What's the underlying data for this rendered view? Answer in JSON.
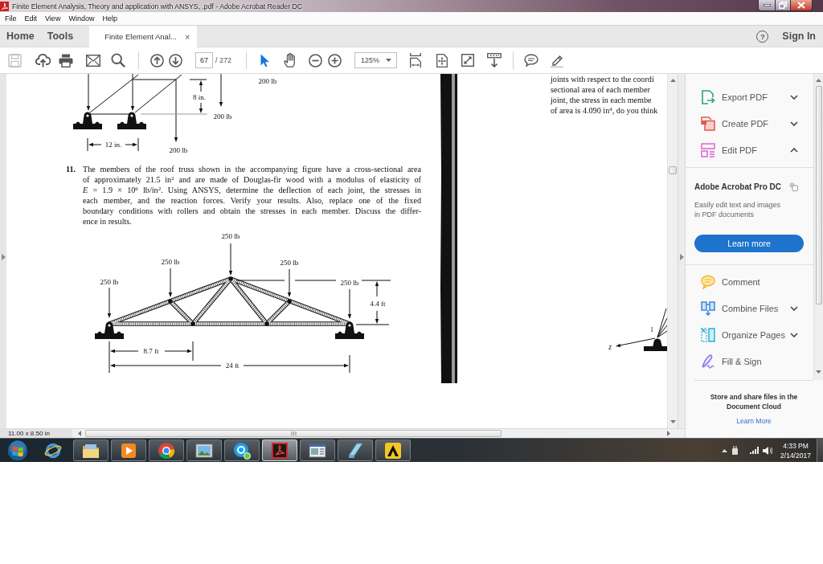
{
  "window": {
    "title": "Finite Element Analysis, Theory and application with ANSYS, .pdf - Adobe Acrobat Reader DC"
  },
  "menu_bar": [
    "File",
    "Edit",
    "View",
    "Window",
    "Help"
  ],
  "tabs": [
    {
      "kind": "nav",
      "label": "Home",
      "selected": false
    },
    {
      "kind": "nav",
      "label": "Tools",
      "selected": false
    },
    {
      "kind": "document",
      "label": "Finite Element Anal...",
      "close": "×",
      "selected": true
    }
  ],
  "account": {
    "help": "?",
    "sign_in": "Sign In"
  },
  "toolbar": {
    "save": {
      "disabled": true
    },
    "page_number": "67",
    "page_count": "/ 272",
    "pointer_tools": [
      {
        "selected": true
      },
      {
        "selected": false
      }
    ],
    "zoom": "125%"
  },
  "document": {
    "top_figure": {
      "labels": [
        "200 lb",
        "8 in.",
        "200 lb",
        "12 in.",
        "200 lb"
      ]
    },
    "problem": {
      "number": "11.",
      "lines": [
        "The members of the roof truss shown in the accompanying figure have a cross-sectional area",
        "of approximately 21.5 in$^{2}$ and are made of Douglas-fir wood with a modulus of elasticity of",
        "*E* = 1.9 × 10$^{6}$ lb/in$^{2}$. Using ANSYS, determine the deflection of each joint, the stresses in",
        "each member, and the reaction forces. Verify your results. Also, replace one of the fixed",
        "boundary conditions with rollers and obtain the stresses in each member. Discuss the differ-",
        "ence in results."
      ]
    },
    "truss_figure": {
      "labels": [
        "250 lb",
        "250 lb",
        "250 lb",
        "250 lb",
        "250 lb",
        "4.4 ft",
        "8.7 ft",
        "24 ft"
      ]
    },
    "right_column": {
      "lines": [
        "joints with respect to the coordi",
        "sectional area of each member",
        "joint, the stress in each membe",
        "of area is 4.090 in$^{4}$, do you think"
      ]
    },
    "right_figure": {
      "labels": [
        "1",
        "z"
      ]
    }
  },
  "status_bar": {
    "page_size": "11.00 x 8.50 in"
  },
  "tools_panel": {
    "tools": [
      {
        "kind": "expandable",
        "label": "Export PDF",
        "expanded": false
      },
      {
        "kind": "expandable",
        "label": "Create PDF",
        "expanded": false
      },
      {
        "kind": "expandable",
        "label": "Edit PDF",
        "expanded": true
      }
    ],
    "promo": {
      "title": "Adobe Acrobat Pro DC",
      "text": "Easily edit text and images in PDF documents",
      "button": "Learn more"
    },
    "more_tools": [
      {
        "kind": "plain",
        "label": "Comment"
      },
      {
        "kind": "expandable",
        "label": "Combine Files",
        "expanded": false
      },
      {
        "kind": "expandable",
        "label": "Organize Pages",
        "expanded": false
      },
      {
        "kind": "plain",
        "label": "Fill & Sign"
      }
    ],
    "cloud": {
      "text": "Store and share files in the Document Cloud",
      "link": "Learn More"
    }
  },
  "taskbar": {
    "apps": [
      {
        "running": false,
        "selected": false
      },
      {
        "running": true,
        "selected": false
      },
      {
        "running": true,
        "selected": false
      },
      {
        "running": true,
        "selected": false
      },
      {
        "running": true,
        "selected": false
      },
      {
        "running": true,
        "selected": false
      },
      {
        "running": true,
        "selected": true
      },
      {
        "running": true,
        "selected": false
      },
      {
        "running": true,
        "selected": false
      },
      {
        "running": true,
        "selected": false
      }
    ],
    "time": "4:33 PM",
    "date": "2/14/2017"
  }
}
